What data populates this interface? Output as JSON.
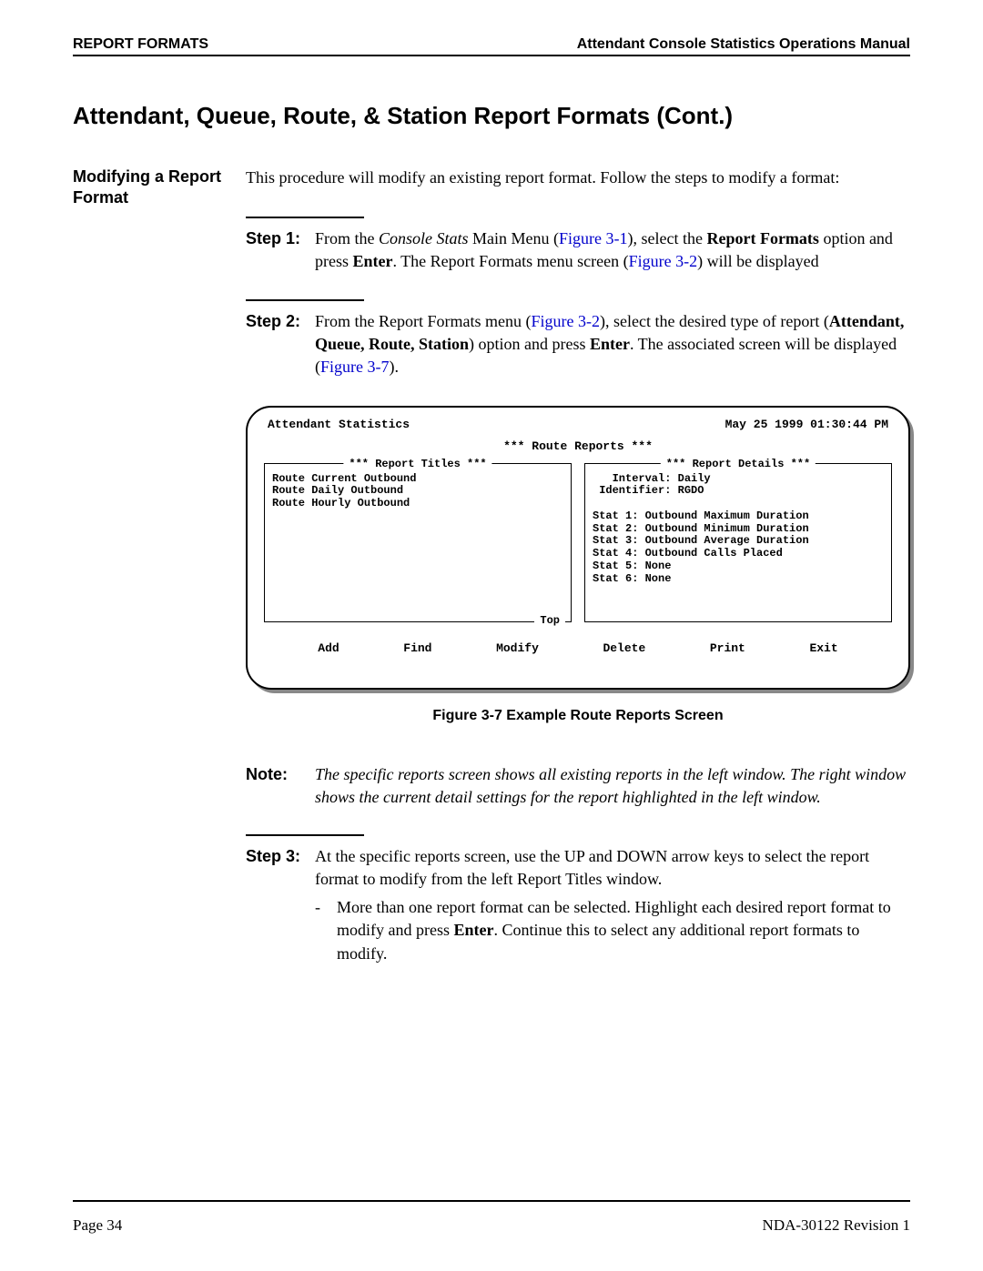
{
  "header": {
    "left": "REPORT FORMATS",
    "right": "Attendant Console Statistics Operations Manual"
  },
  "section_title": "Attendant, Queue, Route, & Station Report Formats (Cont.)",
  "subhead": "Modifying a Report Format",
  "intro": "This procedure will modify an existing report format. Follow the steps to modify a format:",
  "step1": {
    "label": "Step 1:",
    "t1": "From the ",
    "italic1": "Console Stats",
    "t2": " Main Menu (",
    "fig1": "Figure 3-1",
    "t3": "), select the ",
    "bold1": "Report Formats",
    "t4": " option and press ",
    "bold2": "Enter",
    "t5": ". The Report Formats menu screen (",
    "fig2": "Figure 3-2",
    "t6": ") will be displayed"
  },
  "step2": {
    "label": "Step 2:",
    "t1": "From the Report Formats menu (",
    "fig1": "Figure 3-2",
    "t2": "), select the desired type of report (",
    "bold1": "Attendant, Queue, Route, Station",
    "t3": ") option and press ",
    "bold2": "Enter",
    "t4": ". The associated screen will be displayed (",
    "fig2": "Figure 3-7",
    "t5": ")."
  },
  "terminal": {
    "app": "Attendant Statistics",
    "datetime": "May 25 1999  01:30:44 PM",
    "title": "*** Route Reports ***",
    "left_legend": "*** Report Titles ***",
    "left_body": "Route Current Outbound\nRoute Daily Outbound\nRoute Hourly Outbound",
    "left_footer": "Top",
    "right_legend": "*** Report Details ***",
    "right_body": "   Interval: Daily\n Identifier: RGDO\n\nStat 1: Outbound Maximum Duration\nStat 2: Outbound Minimum Duration\nStat 3: Outbound Average Duration\nStat 4: Outbound Calls Placed\nStat 5: None\nStat 6: None",
    "menu": {
      "add": "Add",
      "find": "Find",
      "modify": "Modify",
      "delete": "Delete",
      "print": "Print",
      "exit": "Exit"
    }
  },
  "figure_caption": "Figure 3-7   Example Route Reports Screen",
  "note": {
    "label": "Note:",
    "body": "The specific reports screen shows all existing reports in the left window. The right window shows the current detail settings for the report highlighted in the left window."
  },
  "step3": {
    "label": "Step 3:",
    "body": "At the specific reports screen, use the UP and DOWN arrow keys to select the report format to modify from the left Report Titles window.",
    "dash": "-",
    "bullet_t1": "More than one report format can be selected. Highlight each desired report format to modify and press ",
    "bullet_bold": "Enter",
    "bullet_t2": ". Continue this to select any additional report formats to modify."
  },
  "footer": {
    "page": "Page 34",
    "doc": "NDA-30122   Revision 1"
  }
}
